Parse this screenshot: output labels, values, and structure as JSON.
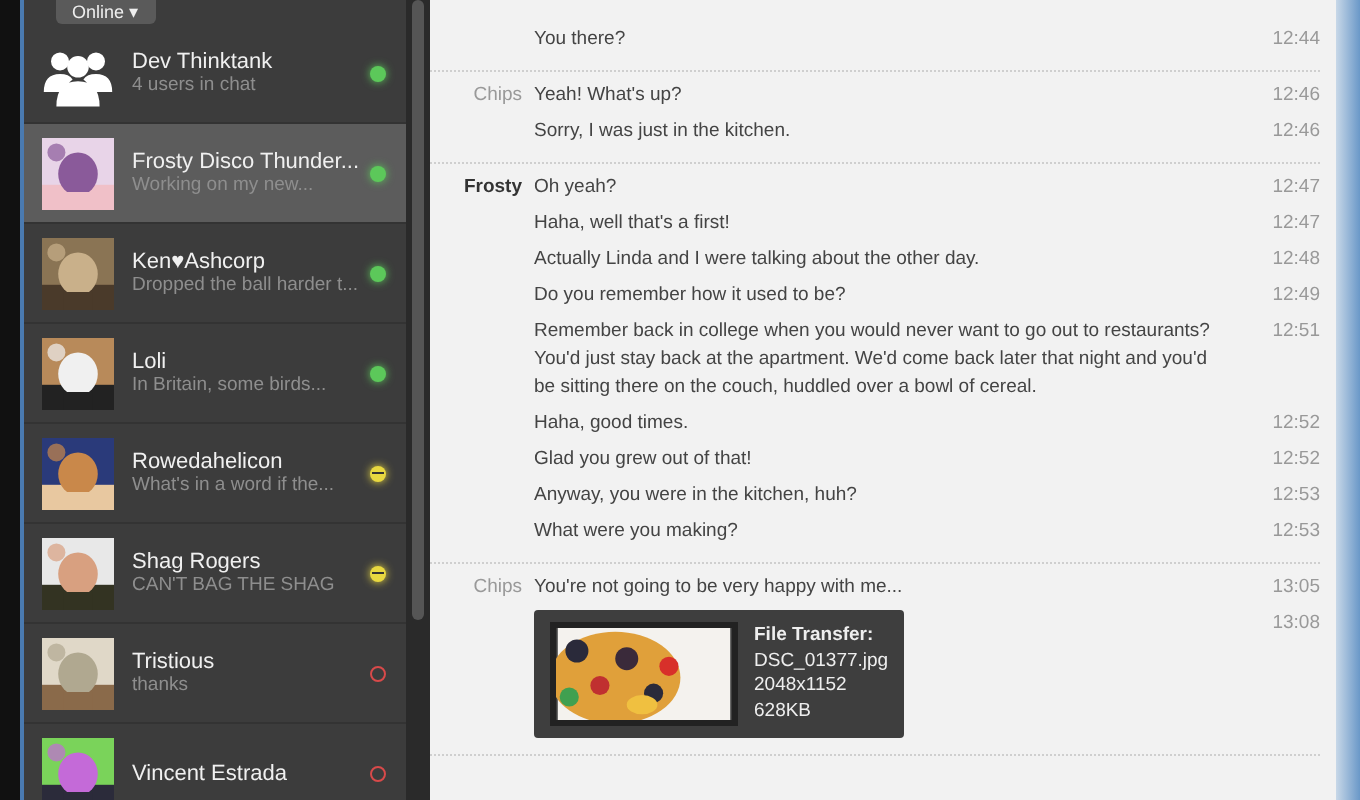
{
  "status_button": {
    "label": "Online",
    "caret": "▾"
  },
  "contacts": [
    {
      "name": "Dev Thinktank",
      "preview": "4 users in chat",
      "color": "#5cc85a",
      "away": false,
      "offline": false,
      "kind": "group",
      "selected": false
    },
    {
      "name": "Frosty Disco Thunder...",
      "preview": "Working on my new...",
      "color": "#5cc85a",
      "away": false,
      "offline": false,
      "kind": "picture",
      "selected": true
    },
    {
      "name": "Ken♥Ashcorp",
      "preview": "Dropped the ball harder t...",
      "color": "#5cc85a",
      "away": false,
      "offline": false,
      "kind": "picture",
      "selected": false
    },
    {
      "name": "Loli",
      "preview": "In Britain, some birds...",
      "color": "#5cc85a",
      "away": false,
      "offline": false,
      "kind": "picture",
      "selected": false
    },
    {
      "name": "Rowedahelicon",
      "preview": "What's in a word if the...",
      "color": "#e8d840",
      "away": true,
      "offline": false,
      "kind": "picture",
      "selected": false
    },
    {
      "name": "Shag Rogers",
      "preview": "CAN'T BAG THE SHAG",
      "color": "#e8d840",
      "away": true,
      "offline": false,
      "kind": "picture",
      "selected": false
    },
    {
      "name": "Tristious",
      "preview": "thanks",
      "color": "#d84a4a",
      "away": false,
      "offline": true,
      "kind": "picture",
      "selected": false
    },
    {
      "name": "Vincent Estrada",
      "color": "#d84a4a",
      "away": false,
      "offline": true,
      "kind": "picture",
      "selected": false
    }
  ],
  "chat": [
    {
      "messages": [
        {
          "kind": "text",
          "text": "You there?",
          "time": "12:44"
        }
      ]
    },
    {
      "sender": "Chips",
      "kind": "self",
      "messages": [
        {
          "kind": "text",
          "text": "Yeah! What's up?",
          "time": "12:46"
        },
        {
          "kind": "text",
          "text": "Sorry, I was just in the kitchen.",
          "time": "12:46"
        }
      ]
    },
    {
      "sender": "Frosty",
      "kind": "other",
      "messages": [
        {
          "kind": "text",
          "text": "Oh yeah?",
          "time": "12:47"
        },
        {
          "kind": "text",
          "text": "Haha, well that's a first!",
          "time": "12:47"
        },
        {
          "kind": "text",
          "text": "Actually Linda and I were talking about the other day.",
          "time": "12:48"
        },
        {
          "kind": "text",
          "text": "Do you remember how it used to be?",
          "time": "12:49"
        },
        {
          "kind": "text",
          "text": "Remember back in college when you would never want to go out to restaurants? You'd just stay back at the apartment. We'd come back later that night and you'd be sitting there on the couch, huddled over a bowl of cereal.",
          "time": "12:51"
        },
        {
          "kind": "text",
          "text": "Haha, good times.",
          "time": "12:52"
        },
        {
          "kind": "text",
          "text": "Glad you grew out of that!",
          "time": "12:52"
        },
        {
          "kind": "text",
          "text": "Anyway, you were in the kitchen, huh?",
          "time": "12:53"
        },
        {
          "kind": "text",
          "text": "What were you making?",
          "time": "12:53"
        }
      ]
    },
    {
      "sender": "Chips",
      "kind": "self",
      "messages": [
        {
          "kind": "text",
          "text": "You're not going to be very happy with me...",
          "time": "13:05"
        },
        {
          "kind": "file",
          "time": "13:08",
          "title": "File Transfer:",
          "lines": [
            "DSC_01377.jpg",
            "2048x1152",
            "628KB"
          ]
        }
      ]
    }
  ]
}
